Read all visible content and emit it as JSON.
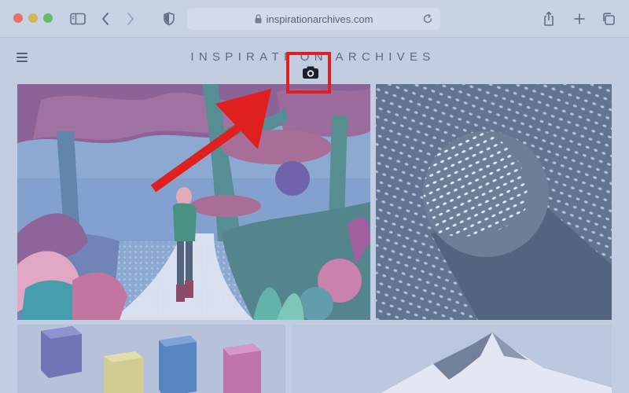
{
  "browser": {
    "url": "inspirationarchives.com",
    "icons": [
      "sidebar-icon",
      "back-icon",
      "forward-icon",
      "shield-icon",
      "lock-icon",
      "reload-icon",
      "share-icon",
      "plus-icon",
      "tabs-icon"
    ]
  },
  "site": {
    "title": "INSPIRATI  ON ARCHIVES"
  },
  "gallery": {
    "tiles": [
      "forest-illustration",
      "halftone-sphere",
      "colored-cubes",
      "snowy-mountain"
    ]
  },
  "annotation": {
    "highlight_color": "#e0201f",
    "icon": "camera-icon"
  },
  "colors": {
    "chrome_bg": "#ccd5e6",
    "page_bg": "#c6d0e3",
    "title_color": "#566074"
  }
}
